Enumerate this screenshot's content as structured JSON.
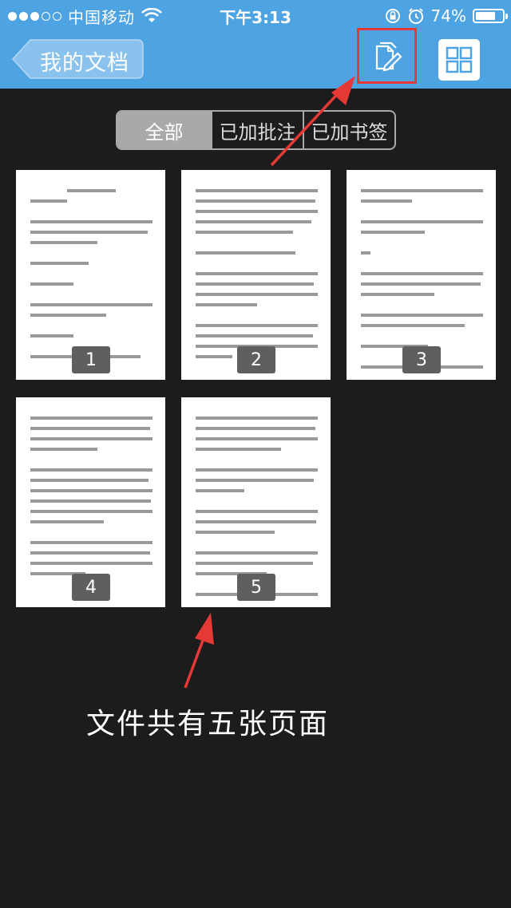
{
  "status": {
    "carrier": "中国移动",
    "time": "下午3:13",
    "battery": "74%",
    "battery_level": 0.74
  },
  "nav": {
    "back_label": "我的文档"
  },
  "filters": [
    {
      "label": "全部",
      "active": true
    },
    {
      "label": "已加批注",
      "active": false
    },
    {
      "label": "已加书签",
      "active": false
    }
  ],
  "pages": [
    {
      "number": "1"
    },
    {
      "number": "2"
    },
    {
      "number": "3"
    },
    {
      "number": "4"
    },
    {
      "number": "5"
    }
  ],
  "annotation": {
    "caption": "文件共有五张页面",
    "color": "#e53935"
  },
  "colors": {
    "header": "#4ea3e3",
    "background": "#1c1c1c"
  }
}
